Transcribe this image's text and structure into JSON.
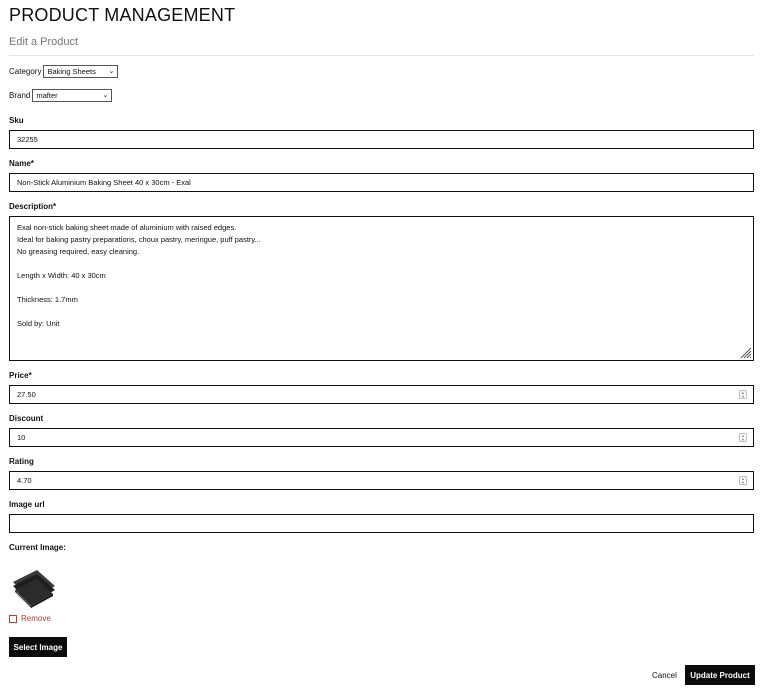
{
  "header": {
    "title": "PRODUCT MANAGEMENT",
    "subtitle": "Edit a Product"
  },
  "form": {
    "category": {
      "label": "Category",
      "value": "Baking Sheets"
    },
    "brand": {
      "label": "Brand",
      "value": "mafter"
    },
    "sku": {
      "label": "Sku",
      "value": "32255"
    },
    "name": {
      "label": "Name*",
      "value": "Non-Stick Aluminium Baking Sheet 40 x 30cm - Exal"
    },
    "description": {
      "label": "Description*",
      "lines": [
        "Exal non-stick baking sheet made of aluminium with raised edges.",
        "Ideal for baking pastry preparations, choux pastry, meringue, puff pastry...",
        "No greasing required, easy cleaning.",
        "",
        "Length x Width: 40 x 30cm",
        "",
        "Thickness: 1.7mm",
        "",
        "Sold by: Unit"
      ]
    },
    "price": {
      "label": "Price*",
      "value": "27.50"
    },
    "discount": {
      "label": "Discount",
      "value": "10"
    },
    "rating": {
      "label": "Rating",
      "value": "4.70"
    },
    "image_url": {
      "label": "Image url",
      "value": ""
    },
    "current_image": {
      "label": "Current Image:",
      "icon": "baking-sheet-thumbnail"
    },
    "remove": {
      "label": "Remove",
      "checked": false
    }
  },
  "actions": {
    "select_image": "Select Image",
    "cancel": "Cancel",
    "update": "Update Product"
  },
  "colors": {
    "button_bg": "#0b0b0b",
    "remove_red": "#c0392b",
    "subtitle_gray": "#777777"
  }
}
